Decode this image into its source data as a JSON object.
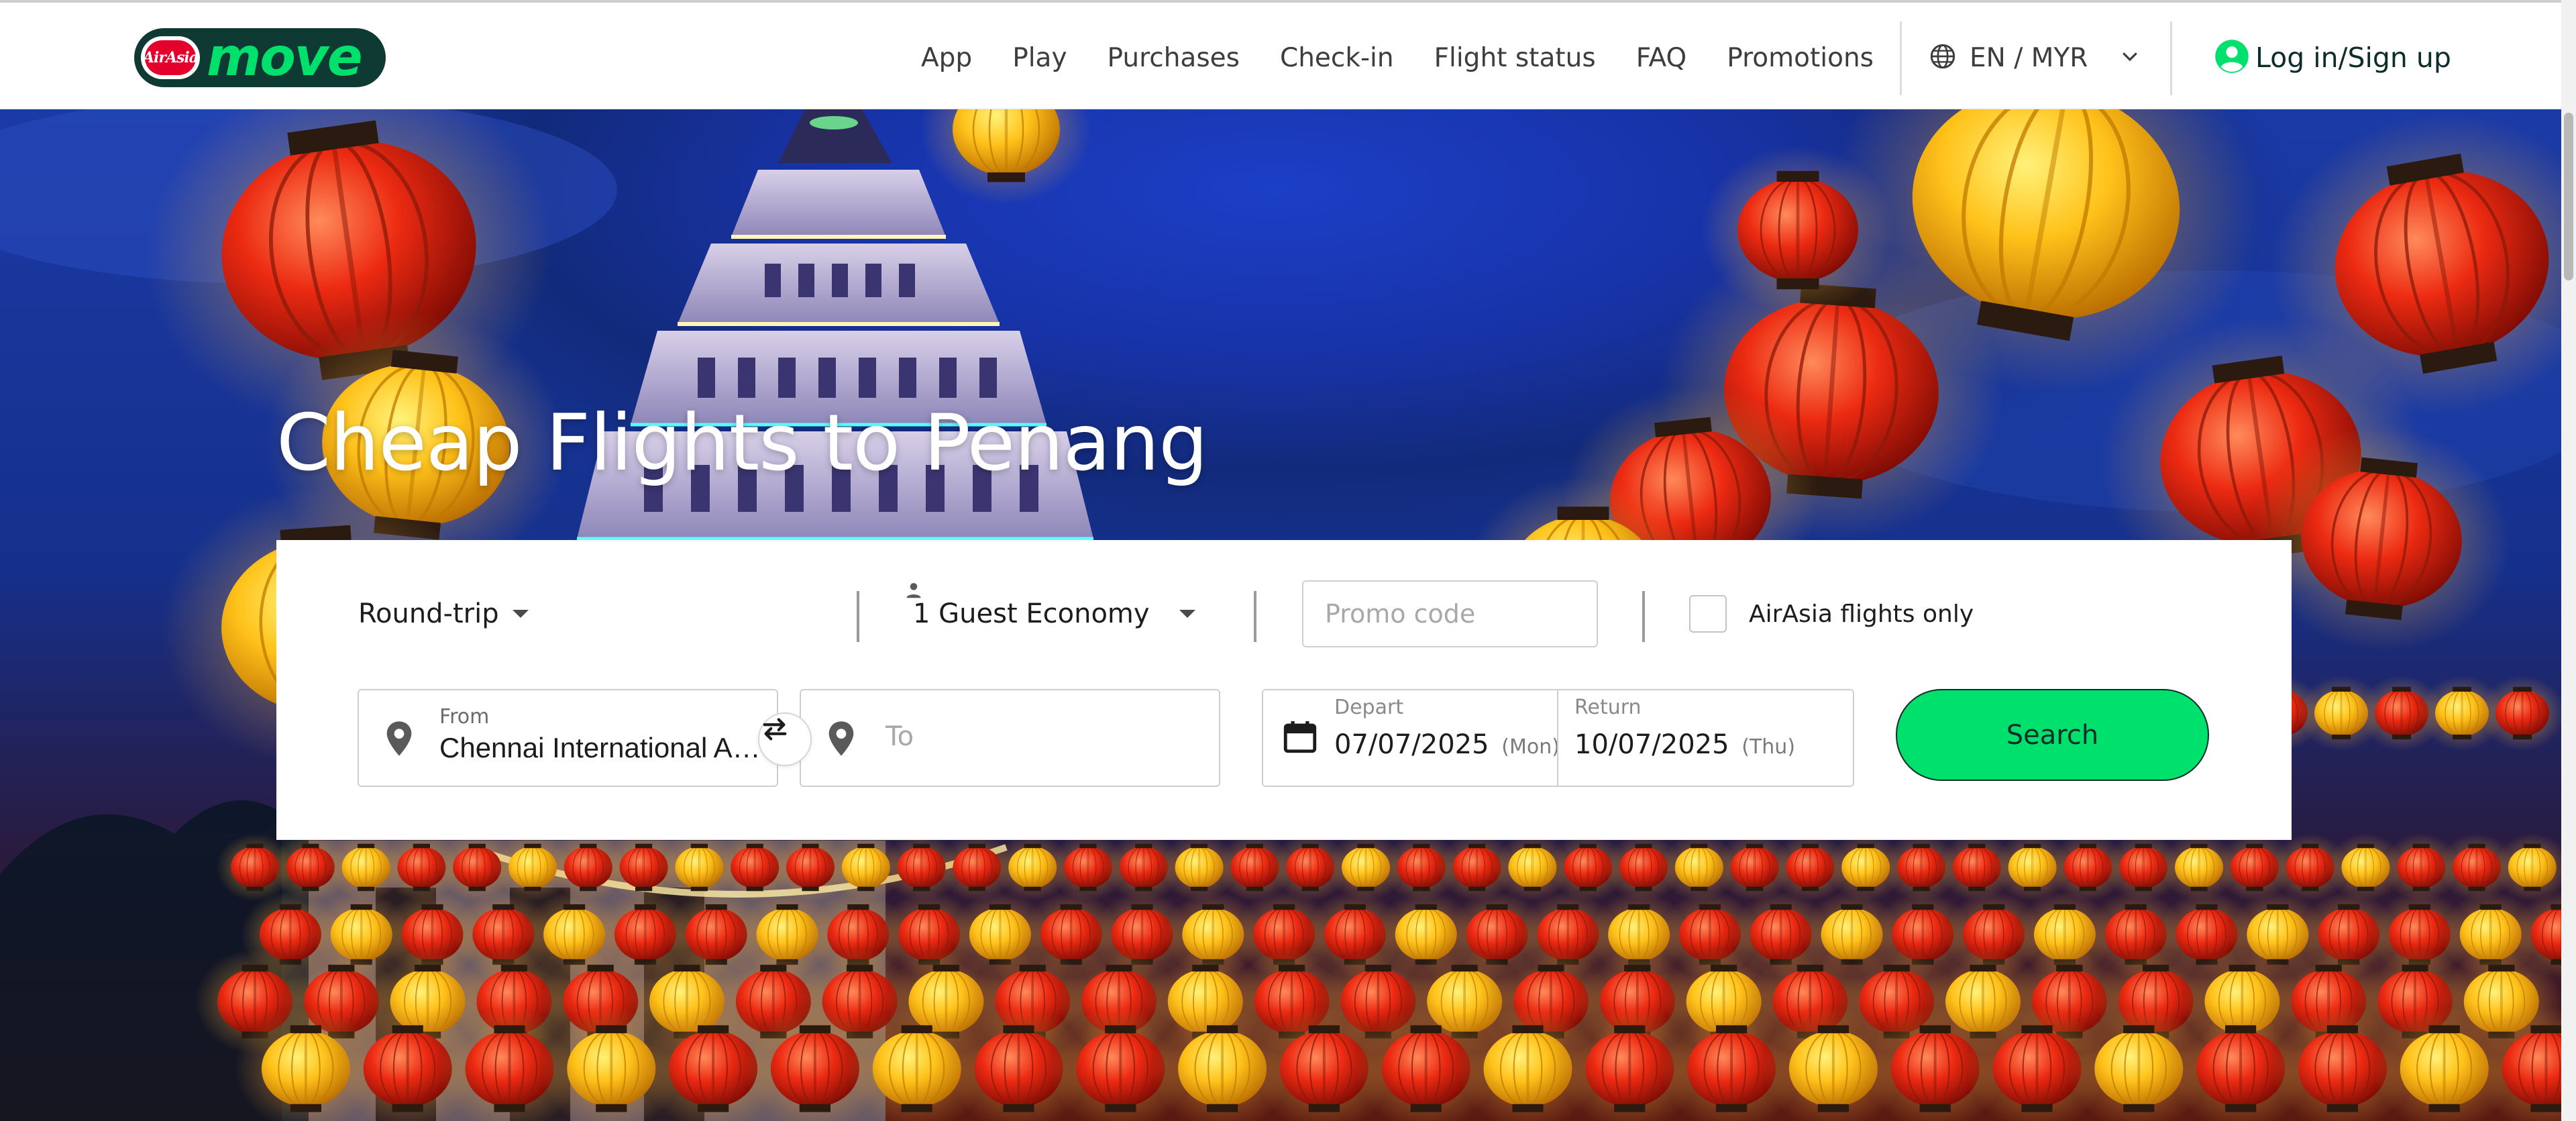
{
  "brand": {
    "badge_text": "AirAsia",
    "wordmark": "move"
  },
  "nav": {
    "items": [
      {
        "label": "App"
      },
      {
        "label": "Play"
      },
      {
        "label": "Purchases"
      },
      {
        "label": "Check-in"
      },
      {
        "label": "Flight status"
      },
      {
        "label": "FAQ"
      },
      {
        "label": "Promotions"
      }
    ],
    "language": "EN / MYR",
    "login": "Log in/Sign up"
  },
  "hero": {
    "title": "Cheap Flights to Penang"
  },
  "search": {
    "trip_type": "Round-trip",
    "guests": "1 Guest Economy",
    "promo_placeholder": "Promo code",
    "airasia_only_label": "AirAsia flights only",
    "airasia_only_checked": false,
    "from_label": "From",
    "from_value": "Chennai International Airport",
    "to_placeholder": "To",
    "depart_label": "Depart",
    "depart_date": "07/07/2025",
    "depart_day": "(Mon)",
    "return_label": "Return",
    "return_date": "10/07/2025",
    "return_day": "(Thu)",
    "search_button": "Search"
  },
  "icons": {
    "globe": "globe-icon",
    "chevron": "chevron-down-icon",
    "user": "user-circle-icon",
    "person": "person-icon",
    "pin": "map-pin-icon",
    "swap": "swap-arrows-icon",
    "calendar": "calendar-icon"
  },
  "colors": {
    "brand_green": "#00e06c",
    "brand_dark": "#0f3a33",
    "airasia_red": "#e4002b",
    "sky": "#1833a8"
  }
}
